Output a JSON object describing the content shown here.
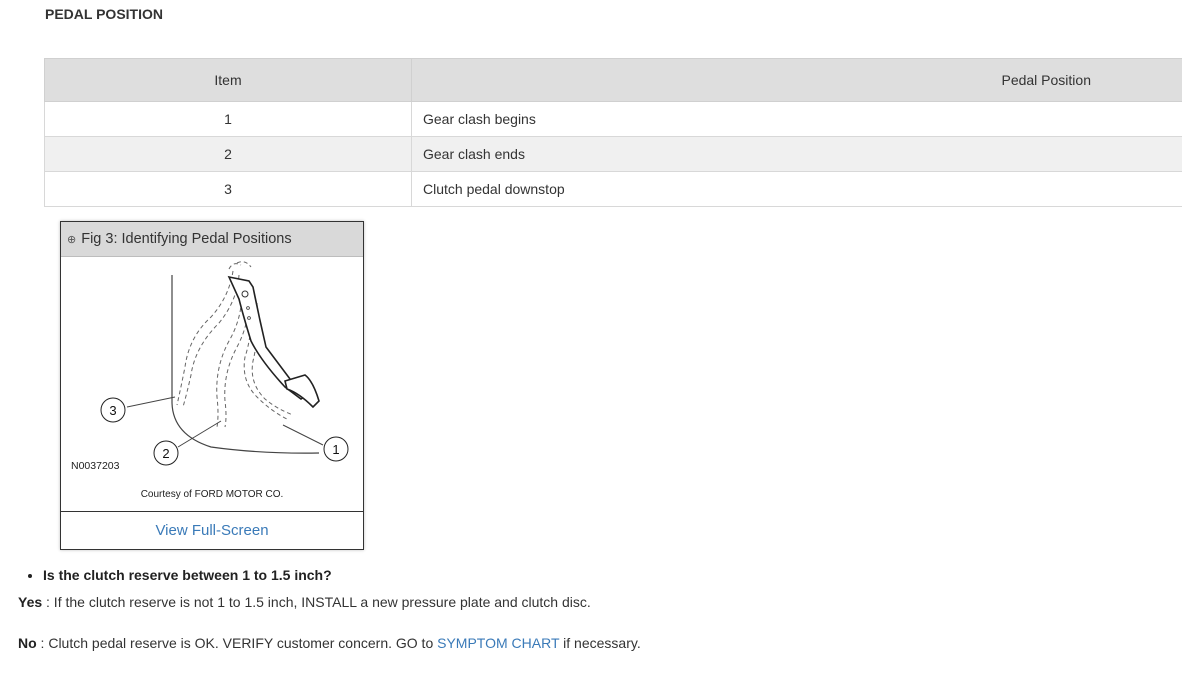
{
  "section_title": "PEDAL POSITION",
  "table": {
    "headers": [
      "Item",
      "Pedal Position"
    ],
    "rows": [
      {
        "item": "1",
        "position": "Gear clash begins"
      },
      {
        "item": "2",
        "position": "Gear clash ends"
      },
      {
        "item": "3",
        "position": "Clutch pedal downstop"
      }
    ]
  },
  "figure": {
    "zoom_icon": "⊕",
    "title": "Fig 3: Identifying Pedal Positions",
    "callouts": [
      "1",
      "2",
      "3"
    ],
    "code": "N0037203",
    "credit": "Courtesy of FORD MOTOR CO.",
    "view_label": "View Full-Screen"
  },
  "question": "Is the clutch reserve between 1 to 1.5 inch?",
  "answers": {
    "yes_label": "Yes",
    "yes_text": " : If the clutch reserve is not 1 to 1.5 inch, INSTALL a new pressure plate and clutch disc.",
    "no_label": "No",
    "no_text": " : Clutch pedal reserve is OK. VERIFY customer concern. GO to ",
    "no_link": "SYMPTOM CHART",
    "no_suffix": " if necessary."
  }
}
